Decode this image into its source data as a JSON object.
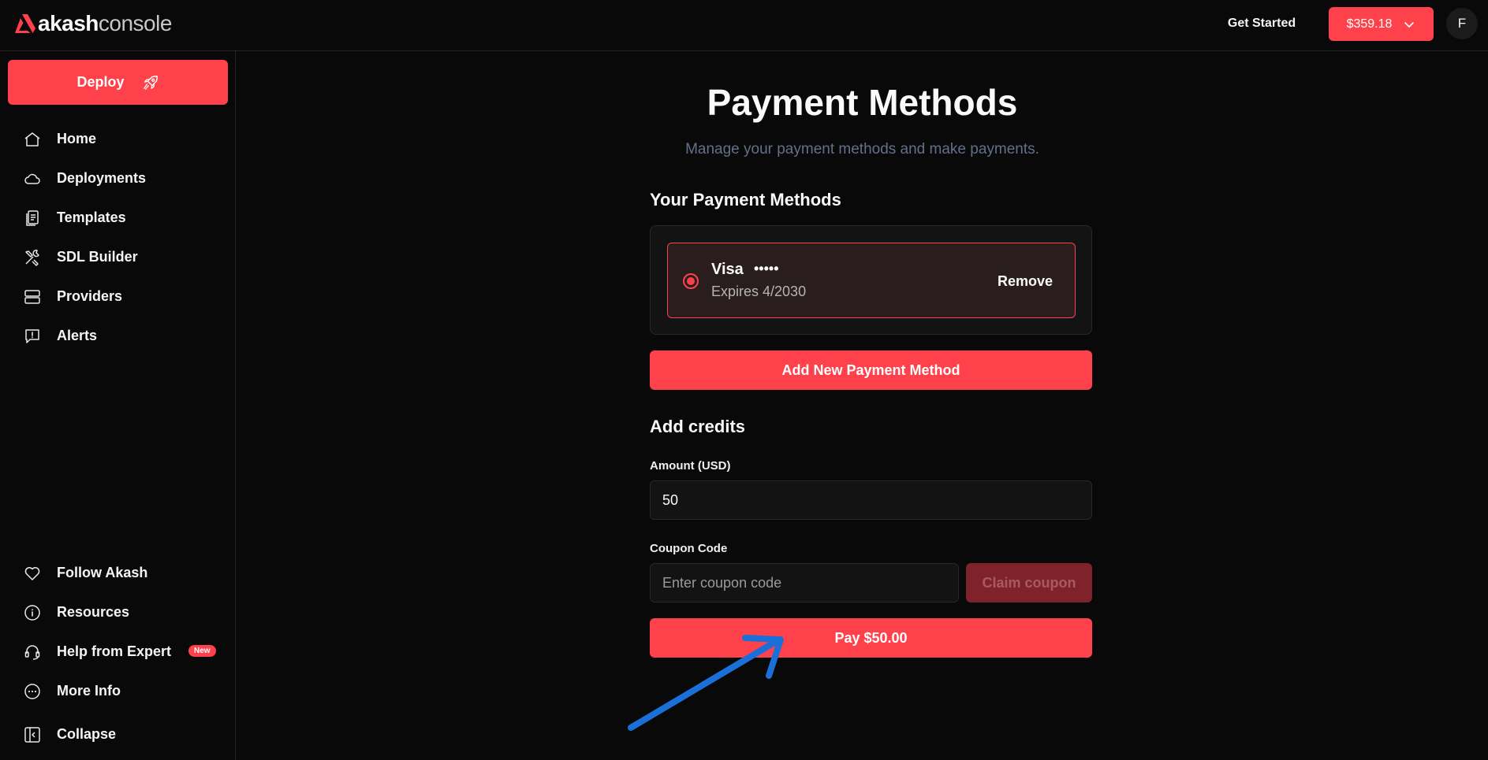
{
  "brand": {
    "logo_akash": "akash",
    "logo_console": "console",
    "accent_color": "#ff414c"
  },
  "header": {
    "get_started": "Get Started",
    "balance": "$359.18",
    "avatar_initial": "F"
  },
  "sidebar": {
    "deploy_label": "Deploy",
    "items": [
      {
        "label": "Home",
        "icon": "home-icon"
      },
      {
        "label": "Deployments",
        "icon": "cloud-icon"
      },
      {
        "label": "Templates",
        "icon": "template-icon"
      },
      {
        "label": "SDL Builder",
        "icon": "tools-icon"
      },
      {
        "label": "Providers",
        "icon": "server-icon"
      },
      {
        "label": "Alerts",
        "icon": "alert-message-icon"
      }
    ],
    "bottom_items": [
      {
        "label": "Follow Akash",
        "icon": "heart-icon"
      },
      {
        "label": "Resources",
        "icon": "info-icon"
      },
      {
        "label": "Help from Expert",
        "icon": "headset-icon",
        "badge": "New"
      },
      {
        "label": "More Info",
        "icon": "more-icon"
      }
    ],
    "collapse_label": "Collapse"
  },
  "main": {
    "title": "Payment Methods",
    "subtitle": "Manage your payment methods and make payments.",
    "your_methods_title": "Your Payment Methods",
    "card": {
      "brand": "Visa",
      "masked": "•••••",
      "expires": "Expires 4/2030",
      "remove_label": "Remove",
      "selected": true
    },
    "add_method_label": "Add New Payment Method",
    "add_credits_title": "Add credits",
    "amount_label": "Amount (USD)",
    "amount_value": "50",
    "coupon_label": "Coupon Code",
    "coupon_placeholder": "Enter coupon code",
    "claim_label": "Claim coupon",
    "pay_label": "Pay $50.00"
  },
  "annotation": {
    "arrow_color": "#1a6fd8",
    "points_to": "pay-button"
  }
}
